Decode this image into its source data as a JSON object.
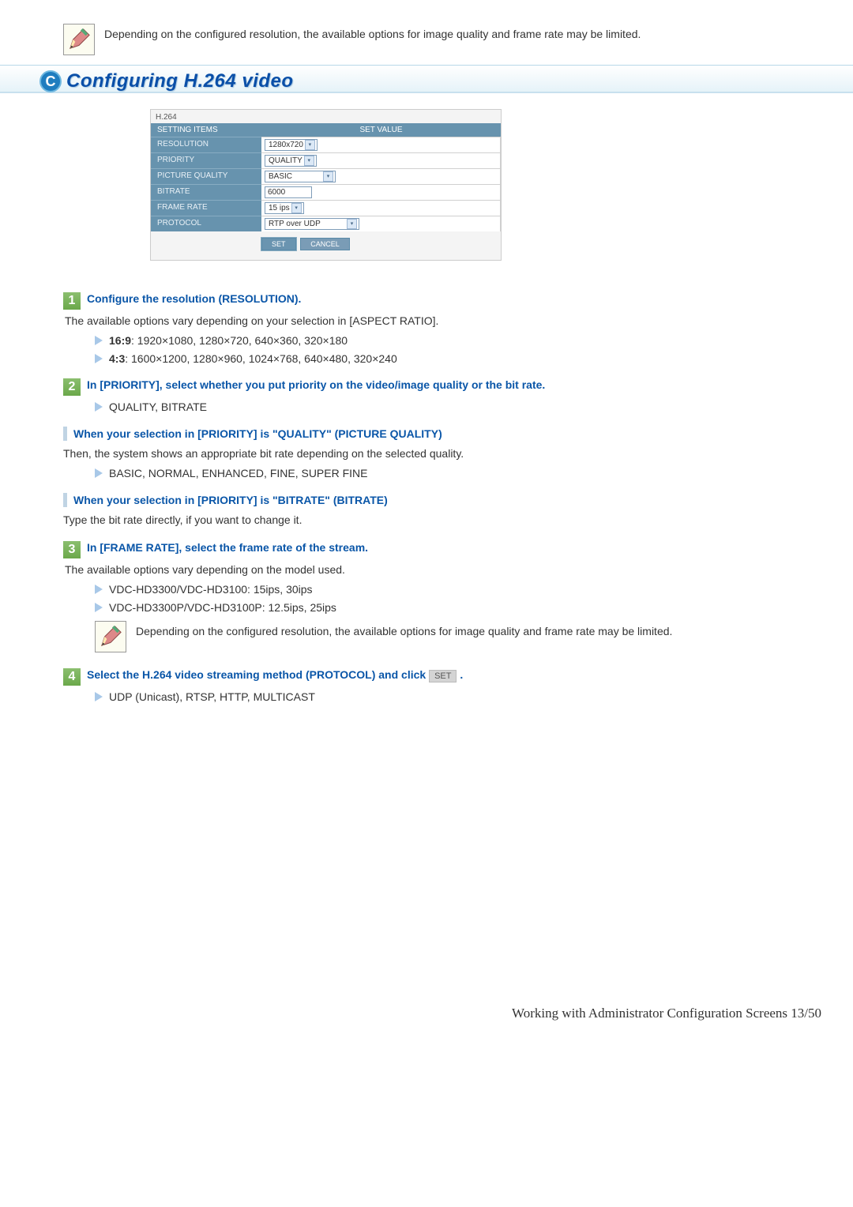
{
  "topNote": "Depending on the configured resolution, the available options for image quality and frame rate may be limited.",
  "section": {
    "letter": "C",
    "title": "Configuring H.264 video"
  },
  "screenshot": {
    "title": "H.264",
    "headerItems": "SETTING ITEMS",
    "headerValue": "SET VALUE",
    "rows": {
      "resolution": {
        "label": "RESOLUTION",
        "value": "1280x720"
      },
      "priority": {
        "label": "PRIORITY",
        "value": "QUALITY"
      },
      "quality": {
        "label": "PICTURE QUALITY",
        "value": "BASIC"
      },
      "bitrate": {
        "label": "BITRATE",
        "value": "6000"
      },
      "framerate": {
        "label": "FRAME RATE",
        "value": "15 ips"
      },
      "protocol": {
        "label": "PROTOCOL",
        "value": "RTP over UDP"
      }
    },
    "setBtn": "SET",
    "cancelBtn": "CANCEL"
  },
  "steps": {
    "s1": {
      "num": "1",
      "title": "Configure the resolution (RESOLUTION).",
      "intro": "The available options vary depending on your selection in [ASPECT RATIO].",
      "b1_label": "16:9",
      "b1_text": ": 1920×1080, 1280×720, 640×360, 320×180",
      "b2_label": "4:3",
      "b2_text": ": 1600×1200, 1280×960, 1024×768, 640×480, 320×240"
    },
    "s2": {
      "num": "2",
      "title": "In [PRIORITY], select whether you put priority on the video/image quality or the bit rate.",
      "b1": "QUALITY, BITRATE"
    },
    "sub1": {
      "title": "When your selection in [PRIORITY] is \"QUALITY\" (PICTURE QUALITY)",
      "text": "Then, the system shows an appropriate bit rate depending on the selected quality.",
      "b1": "BASIC, NORMAL, ENHANCED, FINE, SUPER FINE"
    },
    "sub2": {
      "title": "When your selection in [PRIORITY] is \"BITRATE\" (BITRATE)",
      "text": "Type the bit rate directly, if you want to change it."
    },
    "s3": {
      "num": "3",
      "title": "In [FRAME RATE], select the frame rate of the stream.",
      "intro": "The available options vary depending on the model used.",
      "b1": "VDC-HD3300/VDC-HD3100: 15ips, 30ips",
      "b2": "VDC-HD3300P/VDC-HD3100P: 12.5ips, 25ips",
      "note": "Depending on the configured resolution, the available options for image quality and frame rate may be limited."
    },
    "s4": {
      "num": "4",
      "title_a": "Select the H.264 video streaming method (PROTOCOL) and click ",
      "setLabel": "SET",
      "title_b": " .",
      "b1": "UDP (Unicast), RTSP, HTTP, MULTICAST"
    }
  },
  "footer": "Working with Administrator Configuration Screens 13/50"
}
